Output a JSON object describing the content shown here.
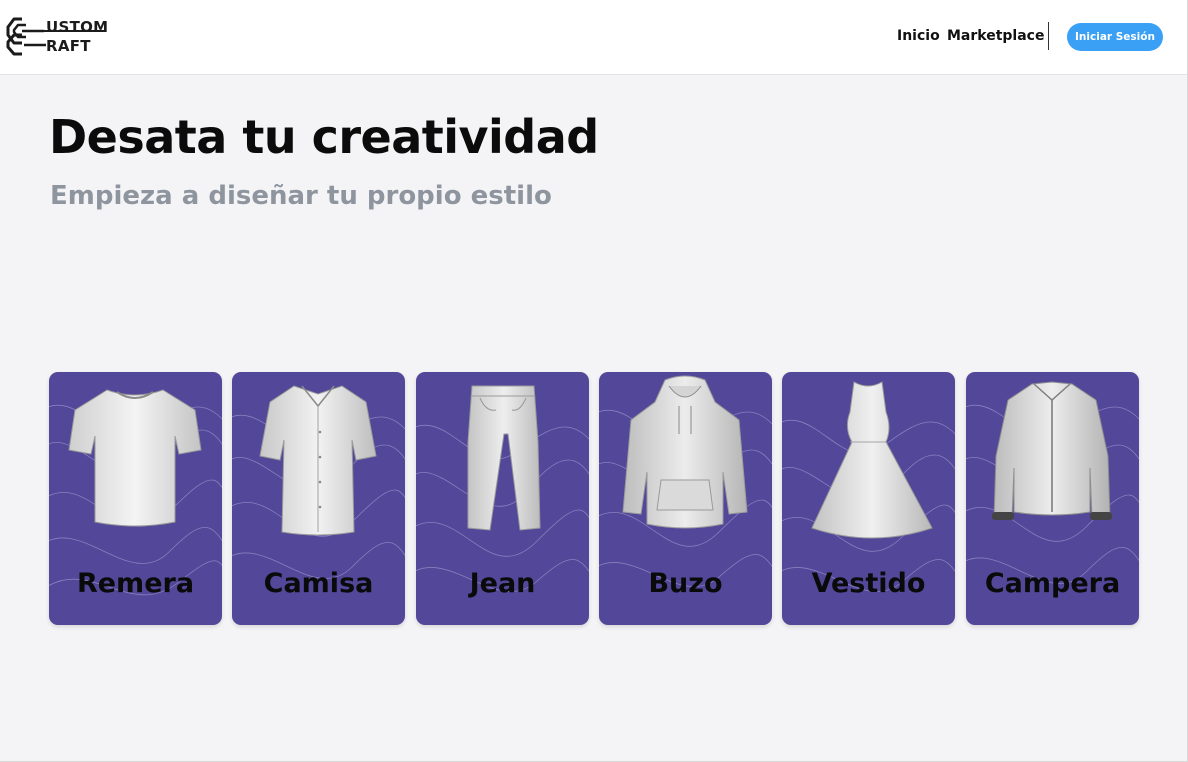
{
  "header": {
    "logo": {
      "line1": "USTOM",
      "line2": "RAFT"
    },
    "nav": {
      "home_label": "Inicio",
      "marketplace_label": "Marketplace"
    },
    "login_label": "Iniciar Sesión"
  },
  "hero": {
    "title": "Desata tu creatividad",
    "subtitle": "Empieza a diseñar tu propio estilo"
  },
  "garments": [
    {
      "label": "Remera",
      "icon": "t-shirt-icon"
    },
    {
      "label": "Camisa",
      "icon": "shirt-icon"
    },
    {
      "label": "Jean",
      "icon": "jeans-icon"
    },
    {
      "label": "Buzo",
      "icon": "hoodie-icon"
    },
    {
      "label": "Vestido",
      "icon": "dress-icon"
    },
    {
      "label": "Campera",
      "icon": "jacket-icon"
    }
  ],
  "colors": {
    "accent": "#3aa0f5",
    "card_bg": "#524799",
    "title": "#0b0b0b",
    "subtitle": "#8f959f",
    "page_bg": "#f4f4f6"
  }
}
